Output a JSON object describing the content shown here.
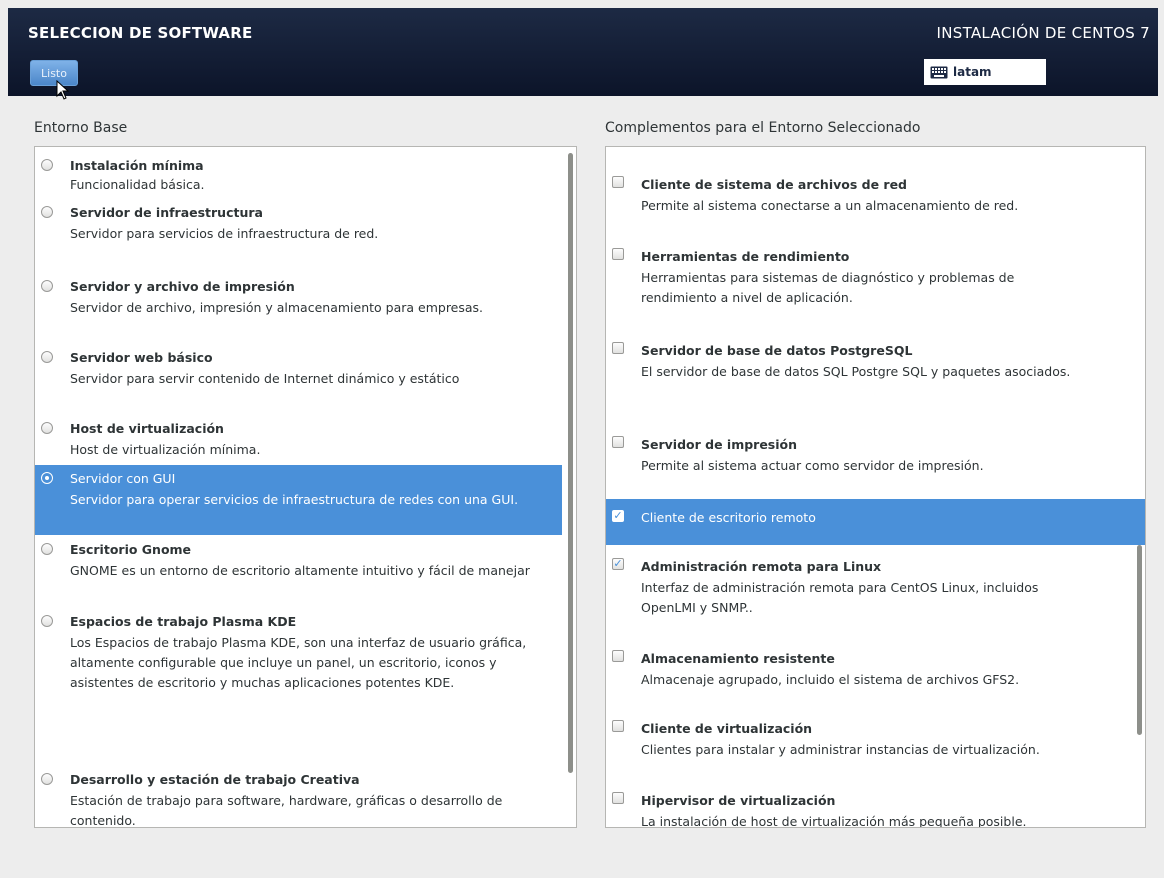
{
  "header": {
    "title": "SELECCION DE SOFTWARE",
    "done_button": "Listo",
    "product": "INSTALACIÓN DE CENTOS 7",
    "keyboard_layout": "latam"
  },
  "left": {
    "label": "Entorno Base",
    "items": [
      {
        "title": "Instalación mínima",
        "desc": "Funcionalidad básica."
      },
      {
        "title": "Servidor de infraestructura",
        "desc": "Servidor para servicios de infraestructura de red."
      },
      {
        "title": "Servidor y archivo de impresión",
        "desc": "Servidor de archivo, impresión y almacenamiento para empresas."
      },
      {
        "title": "Servidor web básico",
        "desc": "Servidor para servir contenido de Internet dinámico y estático"
      },
      {
        "title": "Host de virtualización",
        "desc": "Host de virtualización mínima."
      },
      {
        "title": "Servidor con GUI",
        "desc": "Servidor para operar servicios de infraestructura de redes con una GUI.",
        "selected": true
      },
      {
        "title": "Escritorio Gnome",
        "desc": "GNOME es un entorno de escritorio altamente intuitivo y fácil de manejar"
      },
      {
        "title": "Espacios de trabajo Plasma KDE",
        "desc": "Los Espacios de trabajo Plasma KDE, son una interfaz de usuario gráfica, altamente configurable que incluye un panel, un escritorio, iconos y asistentes de escritorio y muchas aplicaciones potentes KDE."
      },
      {
        "title": "Desarrollo y estación de trabajo Creativa",
        "desc": "Estación de trabajo para software, hardware, gráficas o desarrollo de contenido."
      }
    ]
  },
  "right": {
    "label": "Complementos para el Entorno Seleccionado",
    "items": [
      {
        "title": "Cliente de sistema de archivos de red",
        "desc": "Permite al sistema conectarse a un almacenamiento de red.",
        "checked": false
      },
      {
        "title": "Herramientas de rendimiento",
        "desc": "Herramientas para sistemas de diagnóstico y problemas de rendimiento a nivel de aplicación.",
        "checked": false
      },
      {
        "title": "Servidor de base de datos PostgreSQL",
        "desc": "El servidor de base de datos SQL Postgre SQL y paquetes asociados.",
        "checked": false
      },
      {
        "title": "Servidor de impresión",
        "desc": "Permite al sistema actuar como servidor de impresión.",
        "checked": false
      },
      {
        "title": "Cliente de escritorio remoto",
        "desc": "",
        "checked": true,
        "selected": true
      },
      {
        "title": "Administración remota para Linux",
        "desc": "Interfaz de administración remota para CentOS Linux, incluidos OpenLMI y SNMP..",
        "checked": true
      },
      {
        "title": "Almacenamiento resistente",
        "desc": "Almacenaje agrupado, incluido el sistema de archivos GFS2.",
        "checked": false
      },
      {
        "title": "Cliente de virtualización",
        "desc": "Clientes para instalar y administrar instancias de virtualización.",
        "checked": false
      },
      {
        "title": "Hipervisor de virtualización",
        "desc": "La instalación de host de virtualización más pequeña posible.",
        "checked": false
      }
    ]
  }
}
